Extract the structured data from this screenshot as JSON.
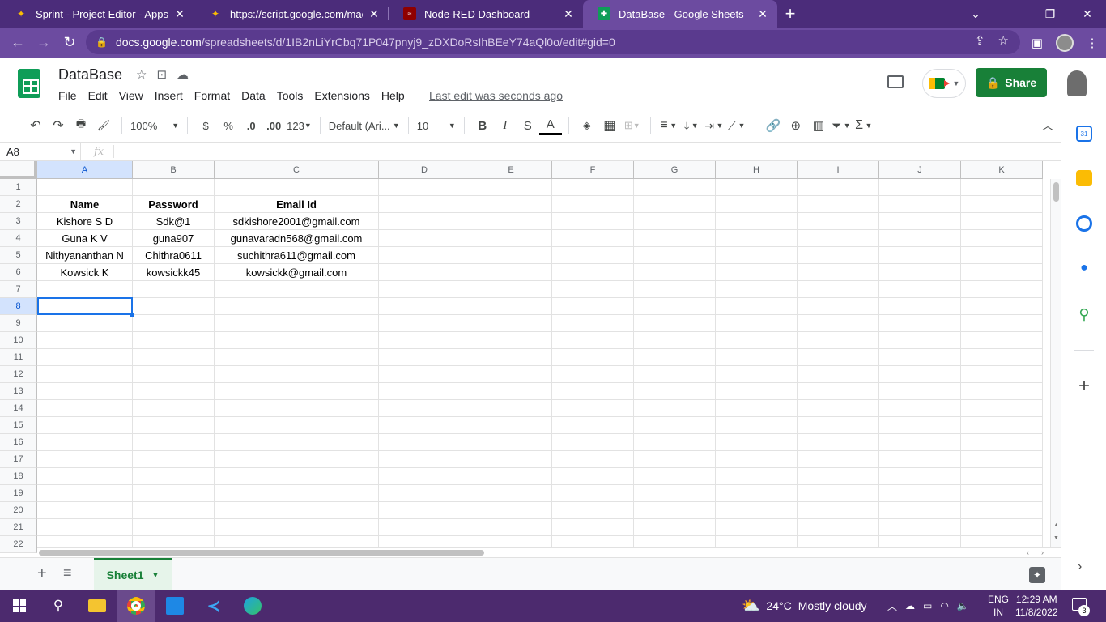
{
  "browser": {
    "tabs": [
      {
        "label": "Sprint - Project Editor - Apps Scri",
        "icon": "apps-script-icon"
      },
      {
        "label": "https://script.google.com/macros",
        "icon": "apps-script-icon"
      },
      {
        "label": "Node-RED Dashboard",
        "icon": "node-red-icon"
      },
      {
        "label": "DataBase - Google Sheets",
        "icon": "sheets-icon",
        "active": true
      }
    ],
    "url_host": "docs.google.com",
    "url_path": "/spreadsheets/d/1IB2nLiYrCbq71P047pnyj9_zDXDoRsIhBEeY74aQl0o/edit#gid=0"
  },
  "sheets": {
    "title": "DataBase",
    "menu": [
      "File",
      "Edit",
      "View",
      "Insert",
      "Format",
      "Data",
      "Tools",
      "Extensions",
      "Help"
    ],
    "last_edit": "Last edit was seconds ago",
    "share_label": "Share",
    "toolbar": {
      "zoom": "100%",
      "currency": "$",
      "percent": "%",
      "dec_decrease": ".0",
      "dec_increase": ".00",
      "more_formats": "123",
      "font": "Default (Ari...",
      "font_size": "10"
    },
    "name_box": "A8",
    "fx": "fx",
    "columns": [
      "A",
      "B",
      "C",
      "D",
      "E",
      "F",
      "G",
      "H",
      "I",
      "J",
      "K"
    ],
    "rows": [
      "1",
      "2",
      "3",
      "4",
      "5",
      "6",
      "7",
      "8",
      "9",
      "10",
      "11",
      "12",
      "13",
      "14",
      "15",
      "16",
      "17",
      "18",
      "19",
      "20",
      "21",
      "22"
    ],
    "header_row": {
      "a": "Name",
      "b": "Password",
      "c": "Email Id"
    },
    "data_rows": [
      {
        "a": "Kishore S D",
        "b": "Sdk@1",
        "c": "sdkishore2001@gmail.com"
      },
      {
        "a": "Guna K V",
        "b": "guna907",
        "c": "gunavaradn568@gmail.com"
      },
      {
        "a": "Nithyananthan N",
        "b": "Chithra0611",
        "c": "suchithra611@gmail.com"
      },
      {
        "a": "Kowsick K",
        "b": "kowsickk45",
        "c": "kowsickk@gmail.com"
      }
    ],
    "sheet_tab": "Sheet1"
  },
  "taskbar": {
    "temperature": "24°C",
    "weather": "Mostly cloudy",
    "lang1": "ENG",
    "lang2": "IN",
    "time": "12:29 AM",
    "date": "11/8/2022",
    "notifications": "3"
  }
}
